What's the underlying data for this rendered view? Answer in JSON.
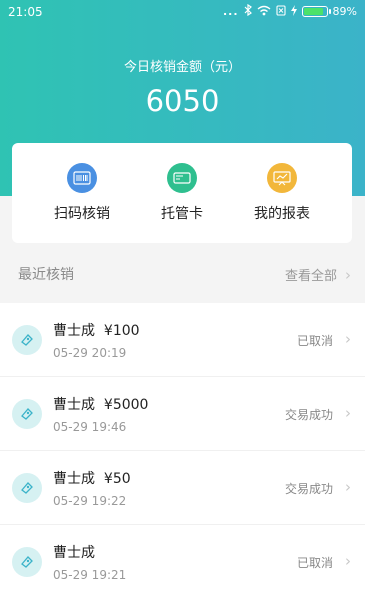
{
  "status_bar": {
    "time": "21:05",
    "dots": "...",
    "battery_percent": "89%",
    "battery_level": 0.89
  },
  "summary": {
    "label": "今日核销金额（元）",
    "amount": "6050"
  },
  "actions": [
    {
      "label": "扫码核销",
      "icon": "barcode-scan-icon",
      "color": "#4a90e2"
    },
    {
      "label": "托管卡",
      "icon": "card-icon",
      "color": "#2fbf8f"
    },
    {
      "label": "我的报表",
      "icon": "report-icon",
      "color": "#f2b73b"
    }
  ],
  "recent": {
    "title": "最近核销",
    "view_all": "查看全部",
    "items": [
      {
        "name": "曹士成",
        "amount": "¥100",
        "date": "05-29 20:19",
        "status": "已取消"
      },
      {
        "name": "曹士成",
        "amount": "¥5000",
        "date": "05-29 19:46",
        "status": "交易成功"
      },
      {
        "name": "曹士成",
        "amount": "¥50",
        "date": "05-29 19:22",
        "status": "交易成功"
      },
      {
        "name": "曹士成",
        "amount": "",
        "date": "05-29 19:21",
        "status": "已取消"
      }
    ]
  },
  "colors": {
    "header_start": "#2fc3b3",
    "header_end": "#3bb3c9",
    "row_icon_bg": "#d6f1f2"
  }
}
